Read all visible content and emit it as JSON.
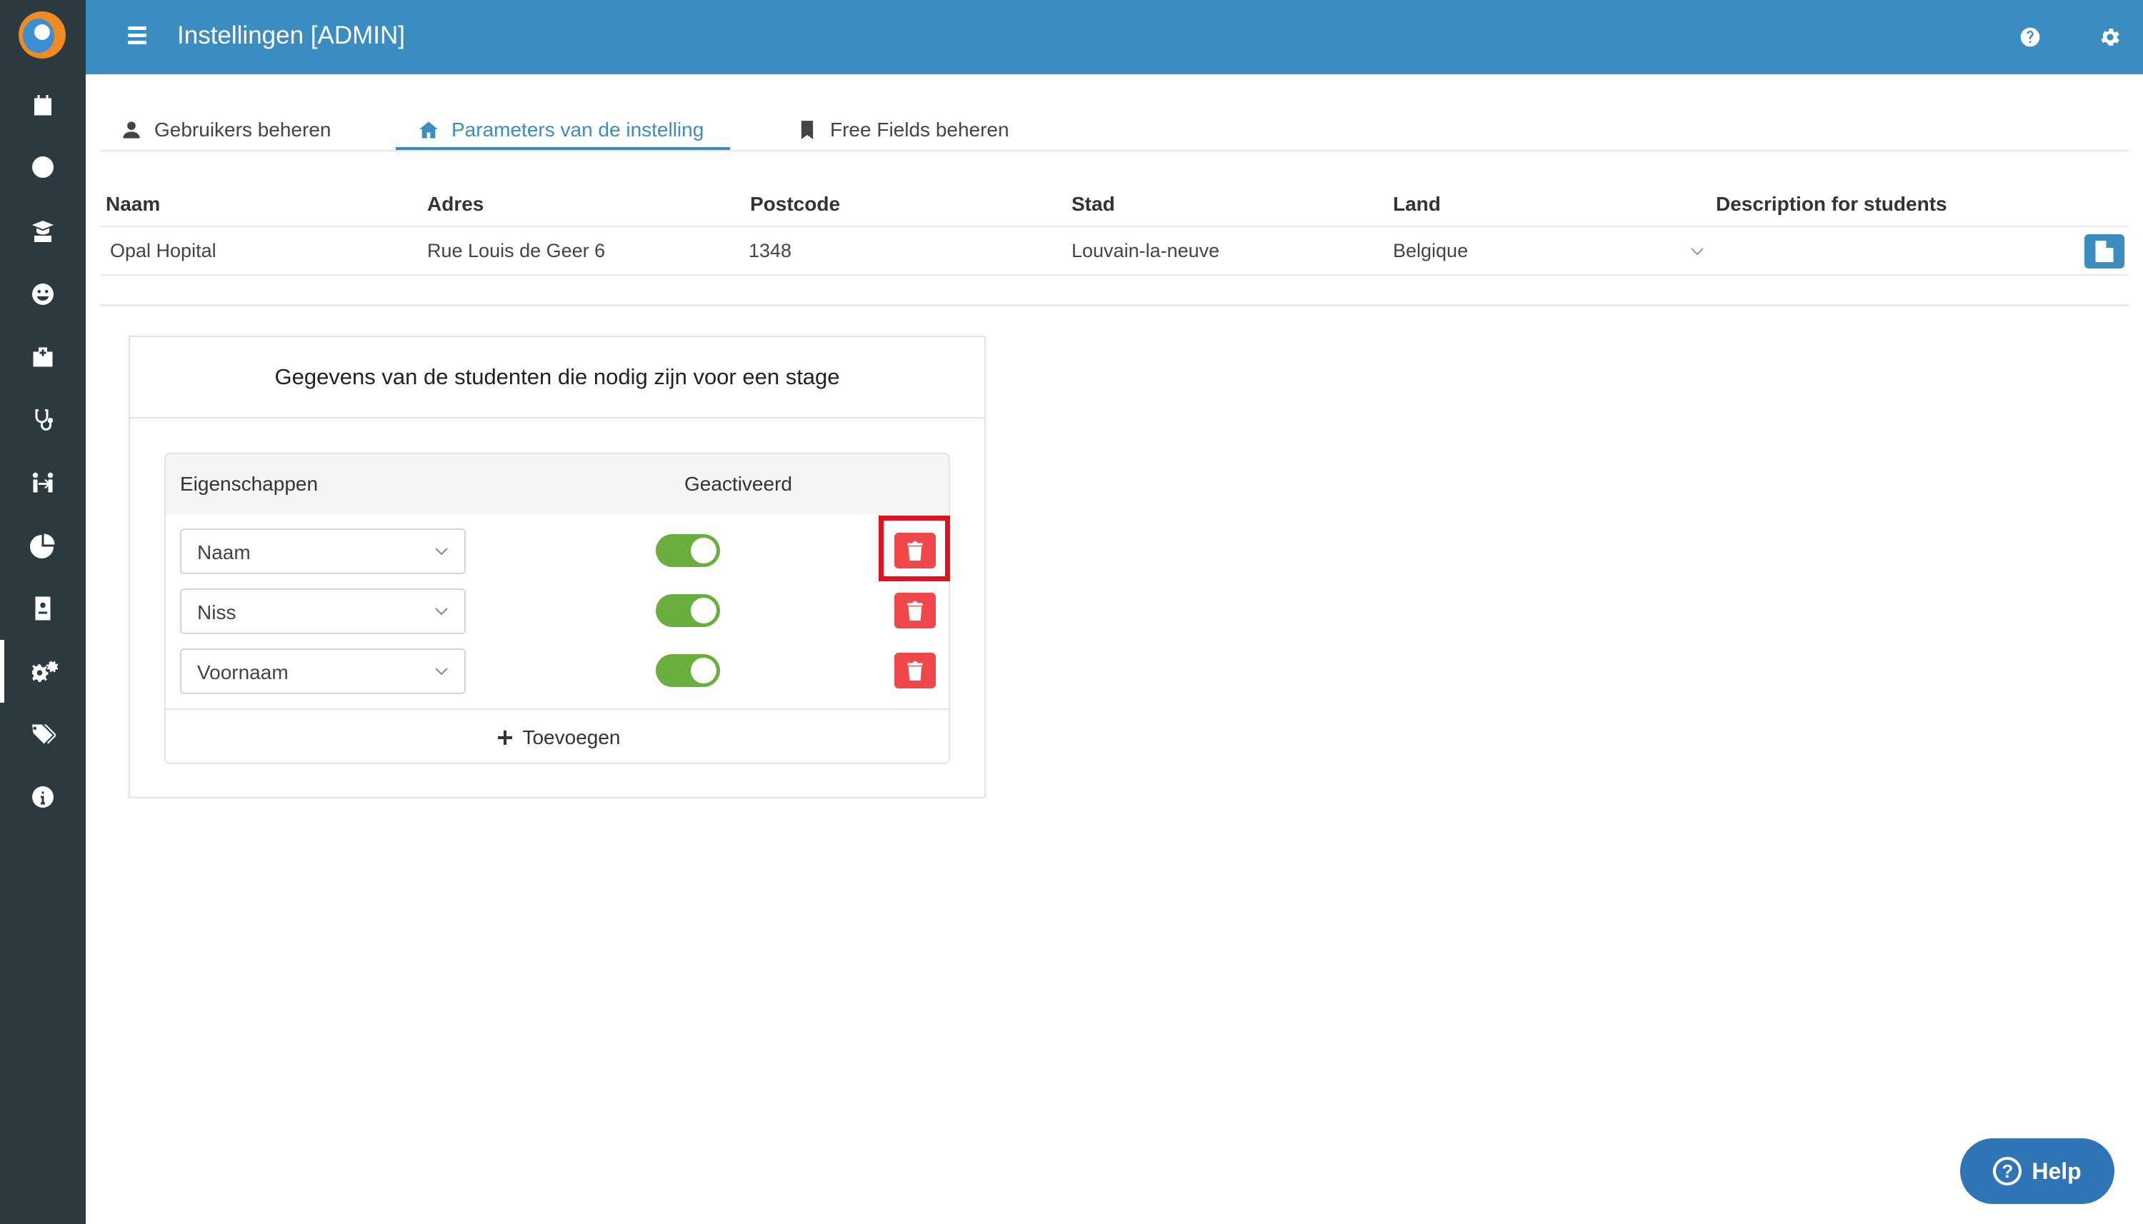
{
  "header": {
    "title": "Instellingen [ADMIN]"
  },
  "sidebar": {
    "items": [
      {
        "icon": "calendar-icon"
      },
      {
        "icon": "clock-icon"
      },
      {
        "icon": "graduate-icon"
      },
      {
        "icon": "smiley-icon"
      },
      {
        "icon": "hospital-icon"
      },
      {
        "icon": "stethoscope-icon"
      },
      {
        "icon": "people-exchange-icon"
      },
      {
        "icon": "pie-chart-icon"
      },
      {
        "icon": "id-card-icon"
      },
      {
        "icon": "settings-cogs-icon"
      },
      {
        "icon": "tags-icon"
      },
      {
        "icon": "info-icon"
      }
    ],
    "active_index": 9
  },
  "tabs": [
    {
      "label": "Gebruikers beheren",
      "icon": "user-icon"
    },
    {
      "label": "Parameters van de instelling",
      "icon": "home-icon",
      "active": true
    },
    {
      "label": "Free Fields beheren",
      "icon": "bookmark-icon"
    }
  ],
  "institution": {
    "columns": [
      "Naam",
      "Adres",
      "Postcode",
      "Stad",
      "Land",
      "Description for students"
    ],
    "row": {
      "naam": "Opal Hopital",
      "adres": "Rue Louis de Geer 6",
      "postcode": "1348",
      "stad": "Louvain-la-neuve",
      "land": "Belgique",
      "description": ""
    }
  },
  "card": {
    "title": "Gegevens van de studenten die nodig zijn voor een stage",
    "col_properties": "Eigenschappen",
    "col_activated": "Geactiveerd",
    "rows": [
      {
        "property": "Naam",
        "activated": true
      },
      {
        "property": "Niss",
        "activated": true
      },
      {
        "property": "Voornaam",
        "activated": true
      }
    ],
    "add_label": "Toevoegen"
  },
  "help": {
    "label": "Help"
  },
  "colors": {
    "primary": "#3b8dc1",
    "sidebar": "#2c3a3f",
    "toggle_on": "#6aaf3d",
    "delete": "#f0474a",
    "highlight": "#e0121f"
  }
}
